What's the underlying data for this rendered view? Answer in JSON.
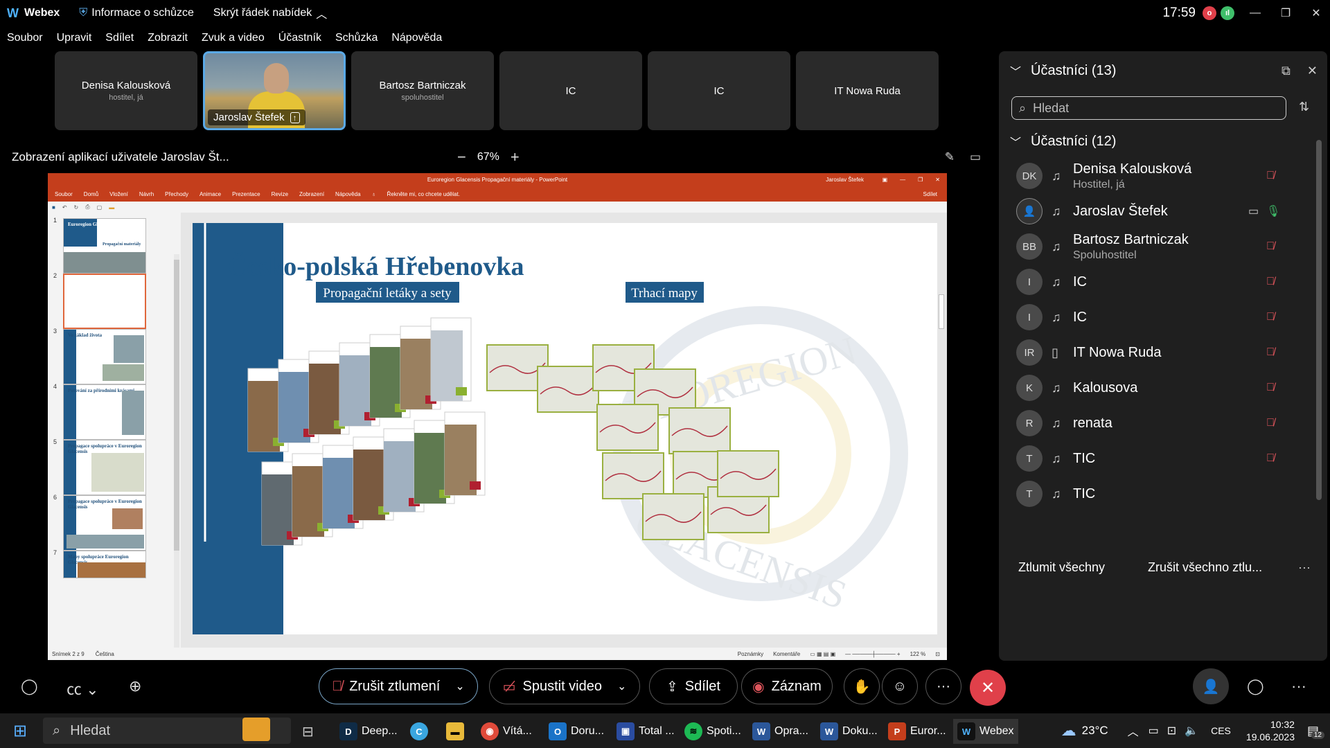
{
  "titlebar": {
    "app_name": "Webex",
    "meeting_info": "Informace o schůzce",
    "hide_menu": "Skrýt řádek nabídek",
    "time": "17:59"
  },
  "menu": [
    "Soubor",
    "Upravit",
    "Sdílet",
    "Zobrazit",
    "Zvuk a video",
    "Účastník",
    "Schůzka",
    "Nápověda"
  ],
  "tiles": [
    {
      "name": "Denisa Kalousková",
      "role": "hostitel, já"
    },
    {
      "name": "Jaroslav Štefek",
      "role": ""
    },
    {
      "name": "Bartosz Bartniczak",
      "role": "spoluhostitel"
    },
    {
      "name": "IC",
      "role": ""
    },
    {
      "name": "IC",
      "role": ""
    },
    {
      "name": "IT Nowa Ruda",
      "role": ""
    }
  ],
  "share": {
    "title": "Zobrazení aplikací uživatele Jaroslav Št...",
    "zoom": "67%"
  },
  "ppt": {
    "window_title": "Euroregion Glacensis Propagační materiály - PowerPoint",
    "user": "Jaroslav Štefek",
    "ribbon": [
      "Soubor",
      "Domů",
      "Vložení",
      "Návrh",
      "Přechody",
      "Animace",
      "Prezentace",
      "Revize",
      "Zobrazení",
      "Nápověda",
      "Řekněte mi, co chcete udělat."
    ],
    "share_btn": "Sdílet",
    "status_left": "Snímek 2 z 9",
    "language": "Čeština",
    "notes": "Poznámky",
    "comments": "Komentáře",
    "zoom": "122 %",
    "slide_numbers": [
      "1",
      "2",
      "3",
      "4",
      "5",
      "6",
      "7"
    ],
    "thumb_titles": [
      "Euroregion Glacensis",
      "",
      "Vo základ života",
      "Putování za přírodními krásami",
      "Propagace spolupráce v Euroregion Glacensis",
      "Propagace spolupráce v Euroregion Glacensis",
      "Mapy spolupráce Euroregion Glacensis"
    ],
    "thumb1_sub": "Propagační materiály",
    "slide": {
      "title": "Česko-polská Hřebenovka",
      "label_left": "Propagační letáky a sety",
      "label_right": "Trhací mapy",
      "watermark_top": "EUROREGION",
      "watermark_bottom": "GLACENSIS"
    }
  },
  "participants_panel": {
    "header": "Účastníci (13)",
    "search_placeholder": "Hledat",
    "group": "Účastníci (12)",
    "rows": [
      {
        "initials": "DK",
        "name": "Denisa Kalousková",
        "role": "Hostitel, já",
        "muted": true
      },
      {
        "initials": "",
        "name": "Jaroslav Štefek",
        "role": "",
        "muted": false
      },
      {
        "initials": "BB",
        "name": "Bartosz Bartniczak",
        "role": "Spoluhostitel",
        "muted": true
      },
      {
        "initials": "I",
        "name": "IC",
        "role": "",
        "muted": true
      },
      {
        "initials": "I",
        "name": "IC",
        "role": "",
        "muted": true
      },
      {
        "initials": "IR",
        "name": "IT Nowa Ruda",
        "role": "",
        "muted": true
      },
      {
        "initials": "K",
        "name": "Kalousova",
        "role": "",
        "muted": true
      },
      {
        "initials": "R",
        "name": "renata",
        "role": "",
        "muted": true
      },
      {
        "initials": "T",
        "name": "TIC",
        "role": "",
        "muted": true
      },
      {
        "initials": "T",
        "name": "TIC",
        "role": "",
        "muted": false
      }
    ],
    "mute_all": "Ztlumit všechny",
    "unmute_all": "Zrušit všechno ztlu..."
  },
  "controls": {
    "unmute": "Zrušit ztlumení",
    "start_video": "Spustit video",
    "share": "Sdílet",
    "record": "Záznam"
  },
  "taskbar": {
    "search": "Hledat",
    "apps": [
      "Deep...",
      "Vítá...",
      "Doru...",
      "Total ...",
      "Spoti...",
      "Opra...",
      "Doku...",
      "Euror...",
      "Webex"
    ],
    "weather": "23°C",
    "lang": "CES",
    "time": "10:32",
    "date": "19.06.2023",
    "notifications": "12"
  },
  "colors": {
    "ppt_red": "#c43e1c",
    "slide_blue": "#1f5a8a",
    "mute_red": "#e0555c",
    "end_call": "#e0404a",
    "active_tile": "#5aa9e6"
  }
}
